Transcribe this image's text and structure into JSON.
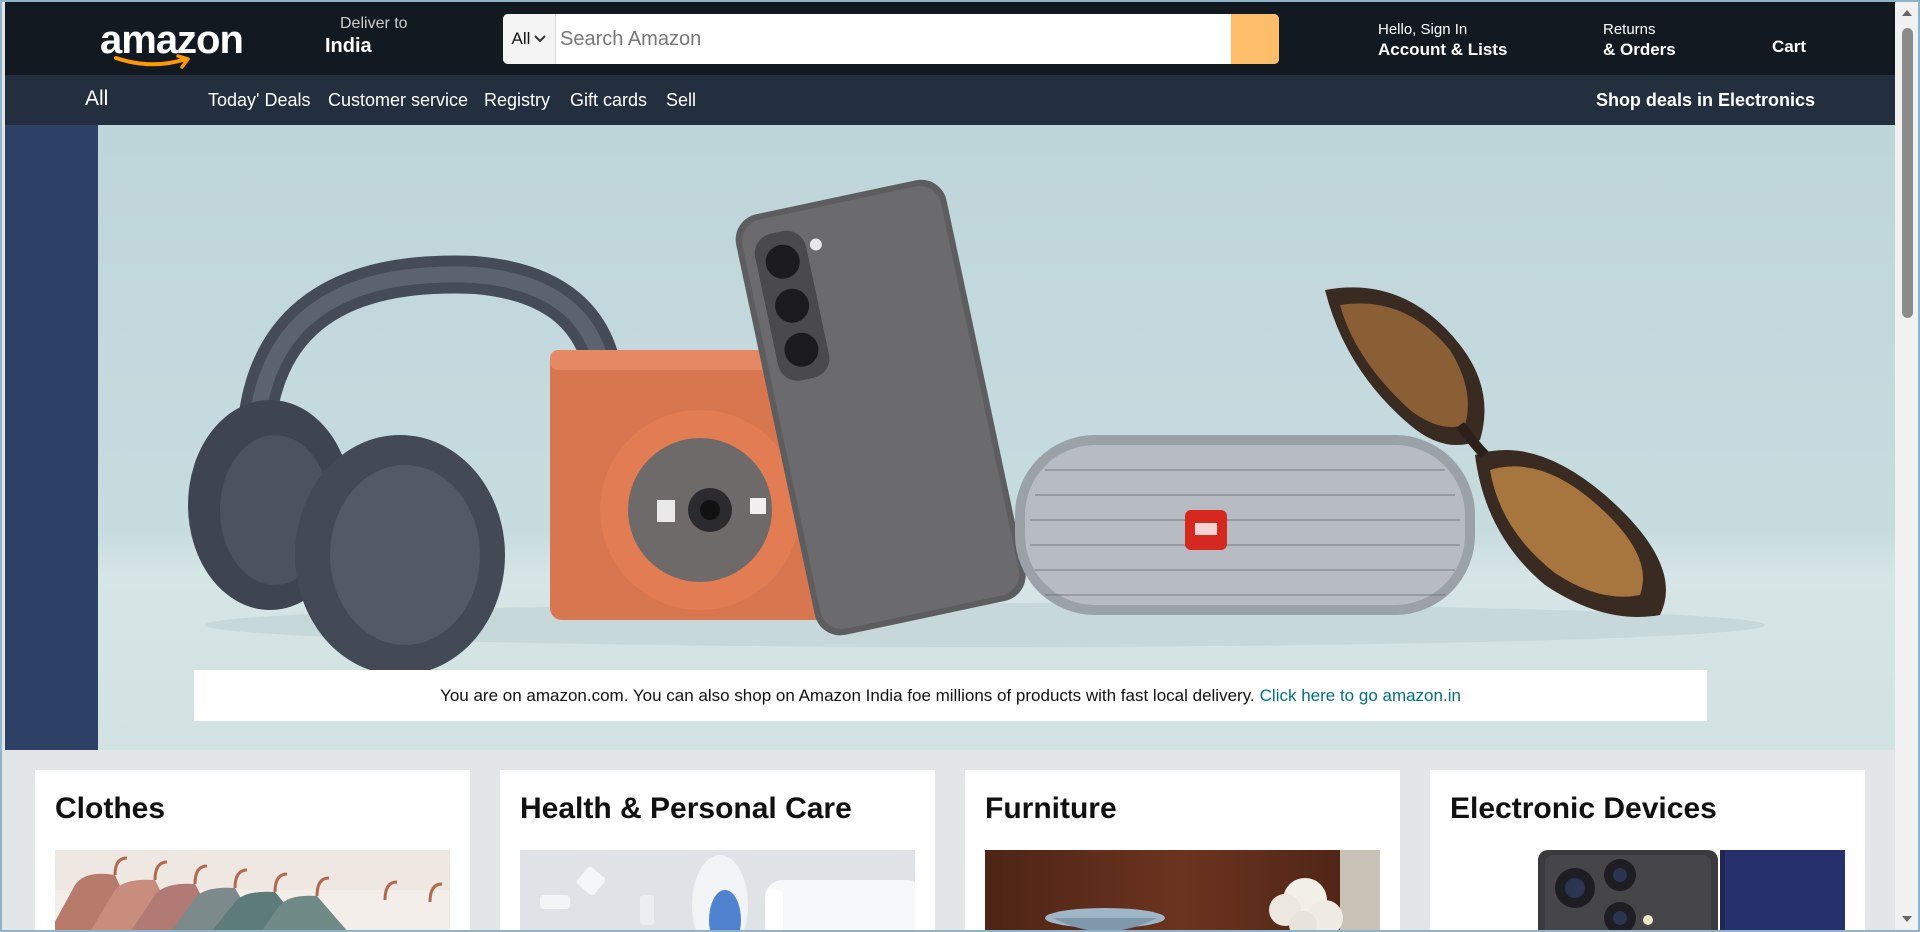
{
  "header": {
    "logo_text": "amazon",
    "deliver_label": "Deliver to",
    "deliver_location": "India",
    "search_category": "All",
    "search_placeholder": "Search Amazon",
    "signin_line1": "Hello, Sign In",
    "signin_line2": "Account & Lists",
    "returns_line1": "Returns",
    "returns_line2": "& Orders",
    "cart_label": "Cart"
  },
  "subnav": {
    "all_label": "All",
    "items": [
      "Today' Deals",
      "Customer service",
      "Registry",
      "Gift cards",
      "Sell"
    ],
    "promo": "Shop deals in Electronics"
  },
  "hero": {
    "notice_text": "You are on amazon.com. You can also shop on Amazon India foe millions of products with fast local delivery.",
    "notice_link": "Click here to go amazon.in"
  },
  "cards": [
    {
      "title": "Clothes"
    },
    {
      "title": "Health & Personal Care"
    },
    {
      "title": "Furniture"
    },
    {
      "title": "Electronic Devices"
    }
  ],
  "colors": {
    "nav_bg": "#131921",
    "subnav_bg": "#232f3e",
    "search_button": "#febd69",
    "link": "#007185"
  }
}
